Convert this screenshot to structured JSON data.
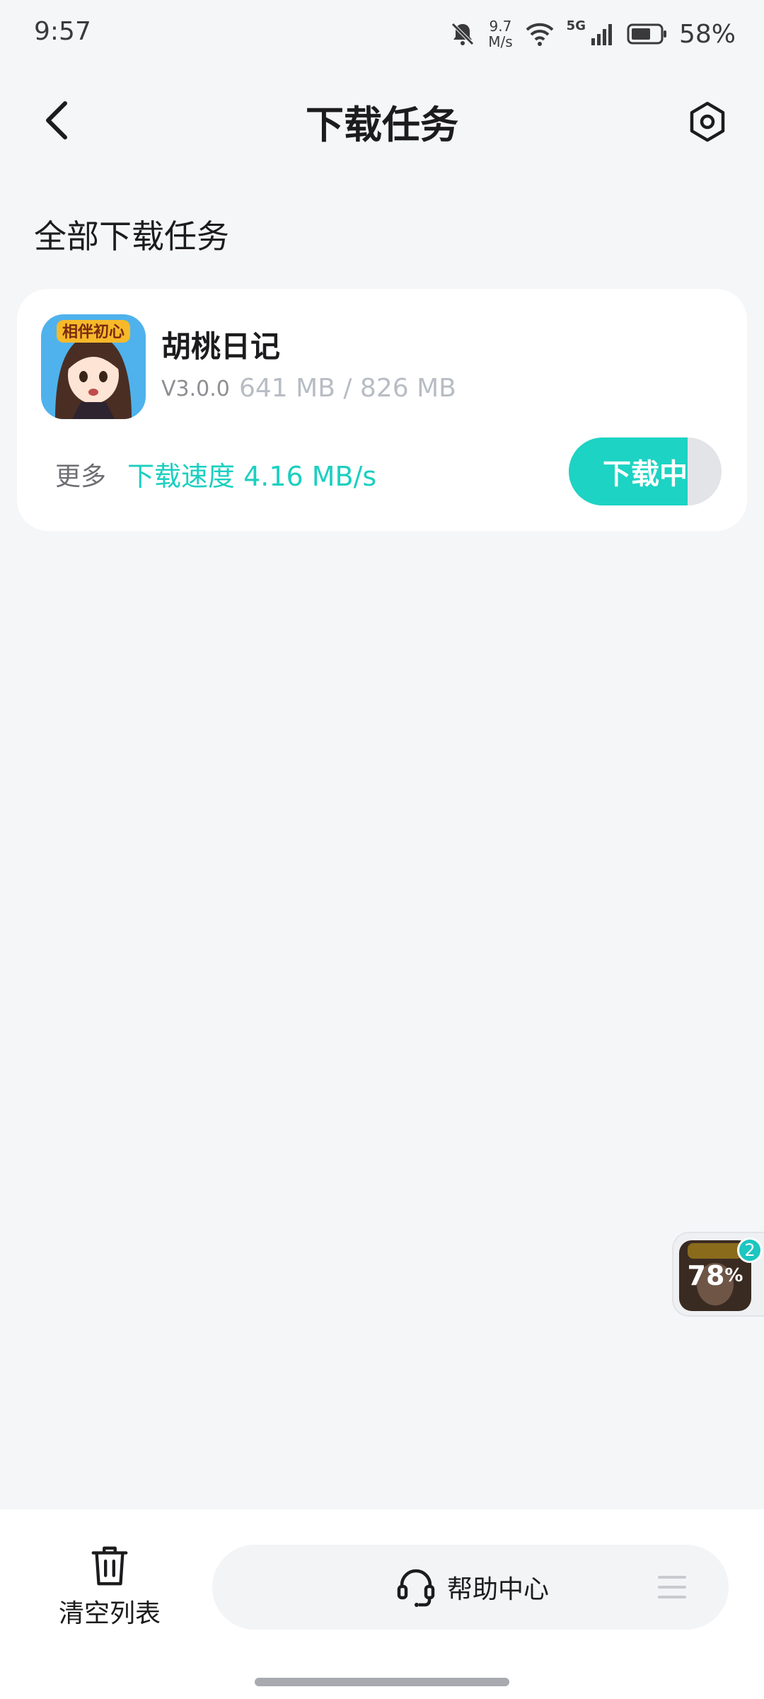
{
  "status_bar": {
    "time": "9:57",
    "net_speed_value": "9.7",
    "net_speed_unit": "M/s",
    "network_type": "5G",
    "battery": "58%"
  },
  "header": {
    "title": "下载任务",
    "back_icon": "chevron-left-icon",
    "settings_icon": "hexagon-settings-icon"
  },
  "section": {
    "title": "全部下载任务"
  },
  "task": {
    "app_name": "胡桃日记",
    "version": "V3.0.0",
    "size": "641 MB / 826 MB",
    "more_label": "更多",
    "speed_text": "下载速度 4.16 MB/s",
    "button_label": "下载中",
    "progress": 0.78,
    "icon_text": "相伴初心"
  },
  "float_widget": {
    "percent": "78",
    "percent_unit": "%",
    "badge": "2"
  },
  "bottom": {
    "clear_label": "清空列表",
    "help_label": "帮助中心"
  },
  "colors": {
    "accent": "#1dd3c3",
    "background": "#f5f6f8",
    "card": "#ffffff"
  }
}
